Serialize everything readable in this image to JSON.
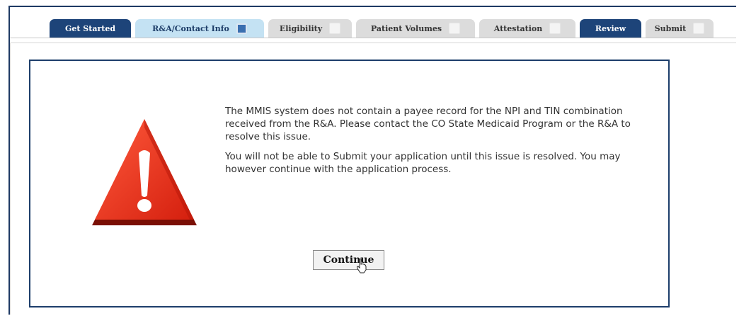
{
  "tabs": [
    {
      "label": "Get Started",
      "style": "dark",
      "checkbox": false
    },
    {
      "label": "R&A/Contact Info",
      "style": "light",
      "checkbox": true
    },
    {
      "label": "Eligibility",
      "style": "gray",
      "checkbox": true
    },
    {
      "label": "Patient Volumes",
      "style": "gray",
      "checkbox": true
    },
    {
      "label": "Attestation",
      "style": "gray",
      "checkbox": true
    },
    {
      "label": "Review",
      "style": "dark",
      "checkbox": false
    },
    {
      "label": "Submit",
      "style": "gray",
      "checkbox": true
    }
  ],
  "dialog": {
    "message_1": "The MMIS system does not contain a payee record for the NPI and TIN combination received from the R&A. Please contact the CO State Medicaid Program or the R&A to resolve this issue.",
    "message_2": "You will not be able to Submit your application until this issue is resolved. You may however continue with the application process.",
    "continue_label": "Continue",
    "icon": "warning-icon"
  },
  "colors": {
    "tab_dark": "#1d4479",
    "tab_light": "#c4e2f3",
    "tab_gray": "#dcdcdc",
    "dialog_border": "#1d3e6b",
    "warning_red": "#e8321f"
  }
}
